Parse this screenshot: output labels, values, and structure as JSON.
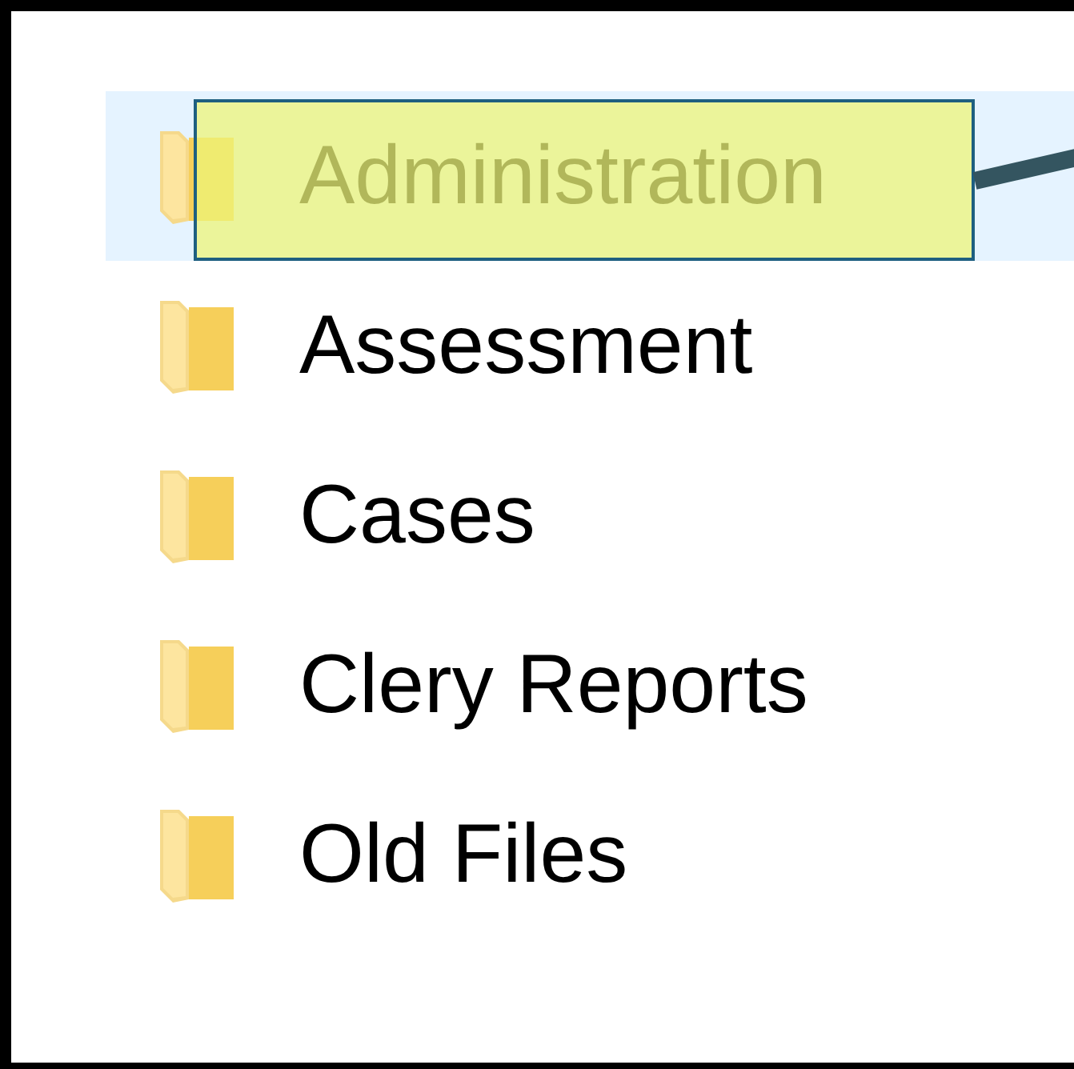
{
  "folders": [
    {
      "name": "Administration",
      "selected": true,
      "annotated": true
    },
    {
      "name": "Assessment",
      "selected": false,
      "annotated": false
    },
    {
      "name": "Cases",
      "selected": false,
      "annotated": false
    },
    {
      "name": "Clery Reports",
      "selected": false,
      "annotated": false
    },
    {
      "name": "Old Files",
      "selected": false,
      "annotated": false
    }
  ]
}
